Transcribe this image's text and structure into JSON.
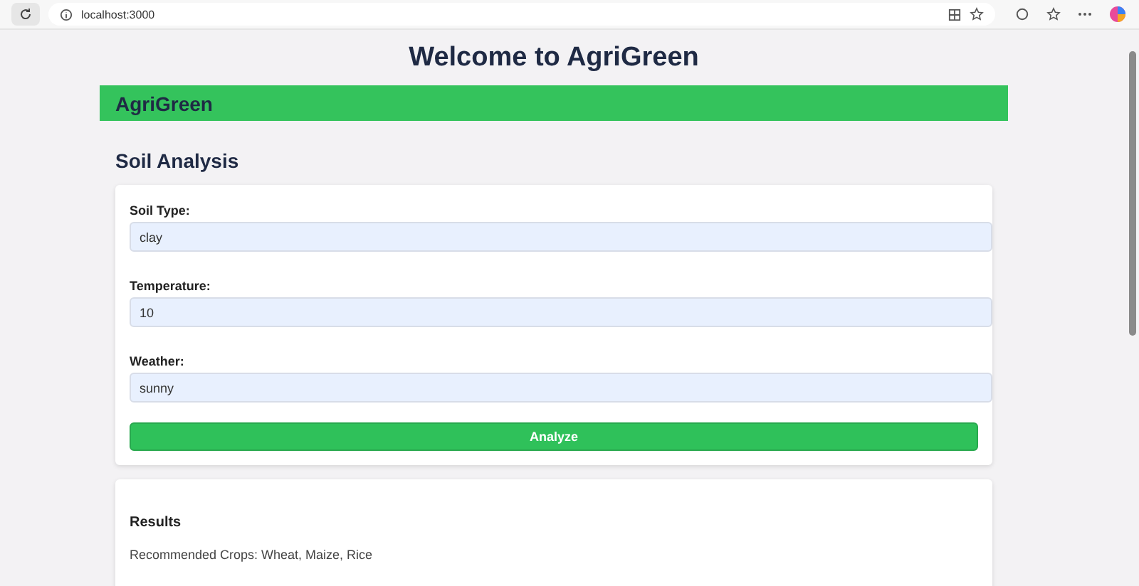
{
  "browser": {
    "url": "localhost:3000"
  },
  "page_title": "Welcome to AgriGreen",
  "brand": "AgriGreen",
  "section_title": "Soil Analysis",
  "fields": [
    {
      "label": "Soil Type:",
      "value": "clay"
    },
    {
      "label": "Temperature:",
      "value": "10"
    },
    {
      "label": "Weather:",
      "value": "sunny"
    }
  ],
  "submit": "Analyze",
  "results": {
    "title": "Results",
    "text": "Recommended Crops: Wheat, Maize, Rice"
  }
}
